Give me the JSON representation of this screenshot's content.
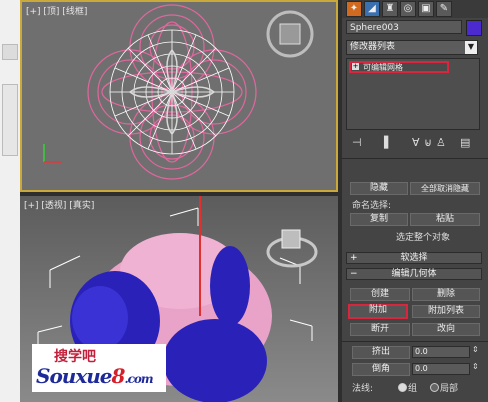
{
  "viewports": {
    "top_label": "[+] [顶] [线框]",
    "persp_label": "[+] [透视] [真实]"
  },
  "command_panel": {
    "tabs": [
      "create-tab",
      "modify-tab",
      "hierarchy-tab",
      "motion-tab",
      "display-tab",
      "utilities-tab"
    ],
    "object_name": "Sphere003",
    "object_color": "#4b2bd0",
    "modifier_list_label": "修改器列表",
    "stack_item": "可编辑网格",
    "selection": {
      "hide_label": "隐藏",
      "unhide_all_label": "全部取消隐藏",
      "named_selection_label": "命名选择:",
      "copy_label": "复制",
      "paste_label": "粘贴",
      "select_whole_label": "选定整个对象"
    },
    "soft_selection_label": "软选择",
    "soft_selection_sign": "+",
    "edit_geometry_label": "编辑几何体",
    "edit_geometry_sign": "−",
    "create_label": "创建",
    "delete_label": "删除",
    "attach_label": "附加",
    "attach_list_label": "附加列表",
    "detach_label": "断开",
    "turn_label": "改向",
    "extrude_label": "挤出",
    "extrude_value": "0.0",
    "chamfer_label": "倒角",
    "chamfer_value": "0.0",
    "normal_label": "法线:",
    "normal_group_label": "组",
    "normal_local_label": "局部"
  },
  "watermark": {
    "cn_text": "搜学吧",
    "en_text_a": "Souxue",
    "en_text_b": "8",
    "en_text_c": ".com"
  }
}
